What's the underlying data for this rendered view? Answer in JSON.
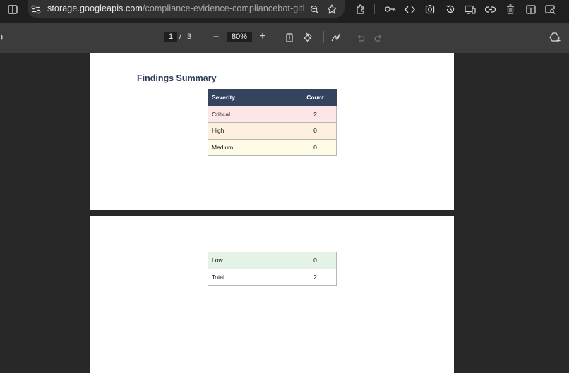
{
  "browser": {
    "url_host": "storage.googleapis.com",
    "url_path": "/compliance-evidence-compliancebot-gitlab-ha...",
    "icons": [
      "split-view-icon",
      "site-info-icon",
      "zoom-icon",
      "bookmark-star-icon",
      "extensions-icon",
      "password-key-icon",
      "devtools-code-icon",
      "screenshot-icon",
      "history-icon",
      "cast-devices-icon",
      "link-icon",
      "delete-icon",
      "reading-mode-icon",
      "search-tab-icon"
    ]
  },
  "pdf_toolbar": {
    "current_page": "1",
    "separator": "/",
    "total_pages": "3",
    "zoom_out_symbol": "−",
    "zoom": "80%",
    "zoom_in_symbol": "+",
    "icons": [
      "fit-page-icon",
      "rotate-icon",
      "draw-icon",
      "undo-icon",
      "redo-icon",
      "save-to-drive-icon"
    ]
  },
  "document": {
    "page1": {
      "heading": "Findings Summary",
      "table": {
        "headers": [
          "Severity",
          "Count"
        ],
        "rows": [
          {
            "severity": "Critical",
            "count": "2",
            "color": "#fde6e8"
          },
          {
            "severity": "High",
            "count": "0",
            "color": "#fdf0e0"
          },
          {
            "severity": "Medium",
            "count": "0",
            "color": "#fefbe6"
          }
        ]
      }
    },
    "page2": {
      "table": {
        "rows": [
          {
            "severity": "Low",
            "count": "0",
            "color": "#e5f3e6"
          },
          {
            "severity": "Total",
            "count": "2",
            "color": "#ffffff"
          }
        ]
      }
    }
  },
  "colors": {
    "topbar": "#1f1f1f",
    "pdf_toolbar": "#3c3c3c",
    "viewer_bg": "#282828",
    "table_header": "#34445e",
    "heading": "#2c3e5c"
  }
}
